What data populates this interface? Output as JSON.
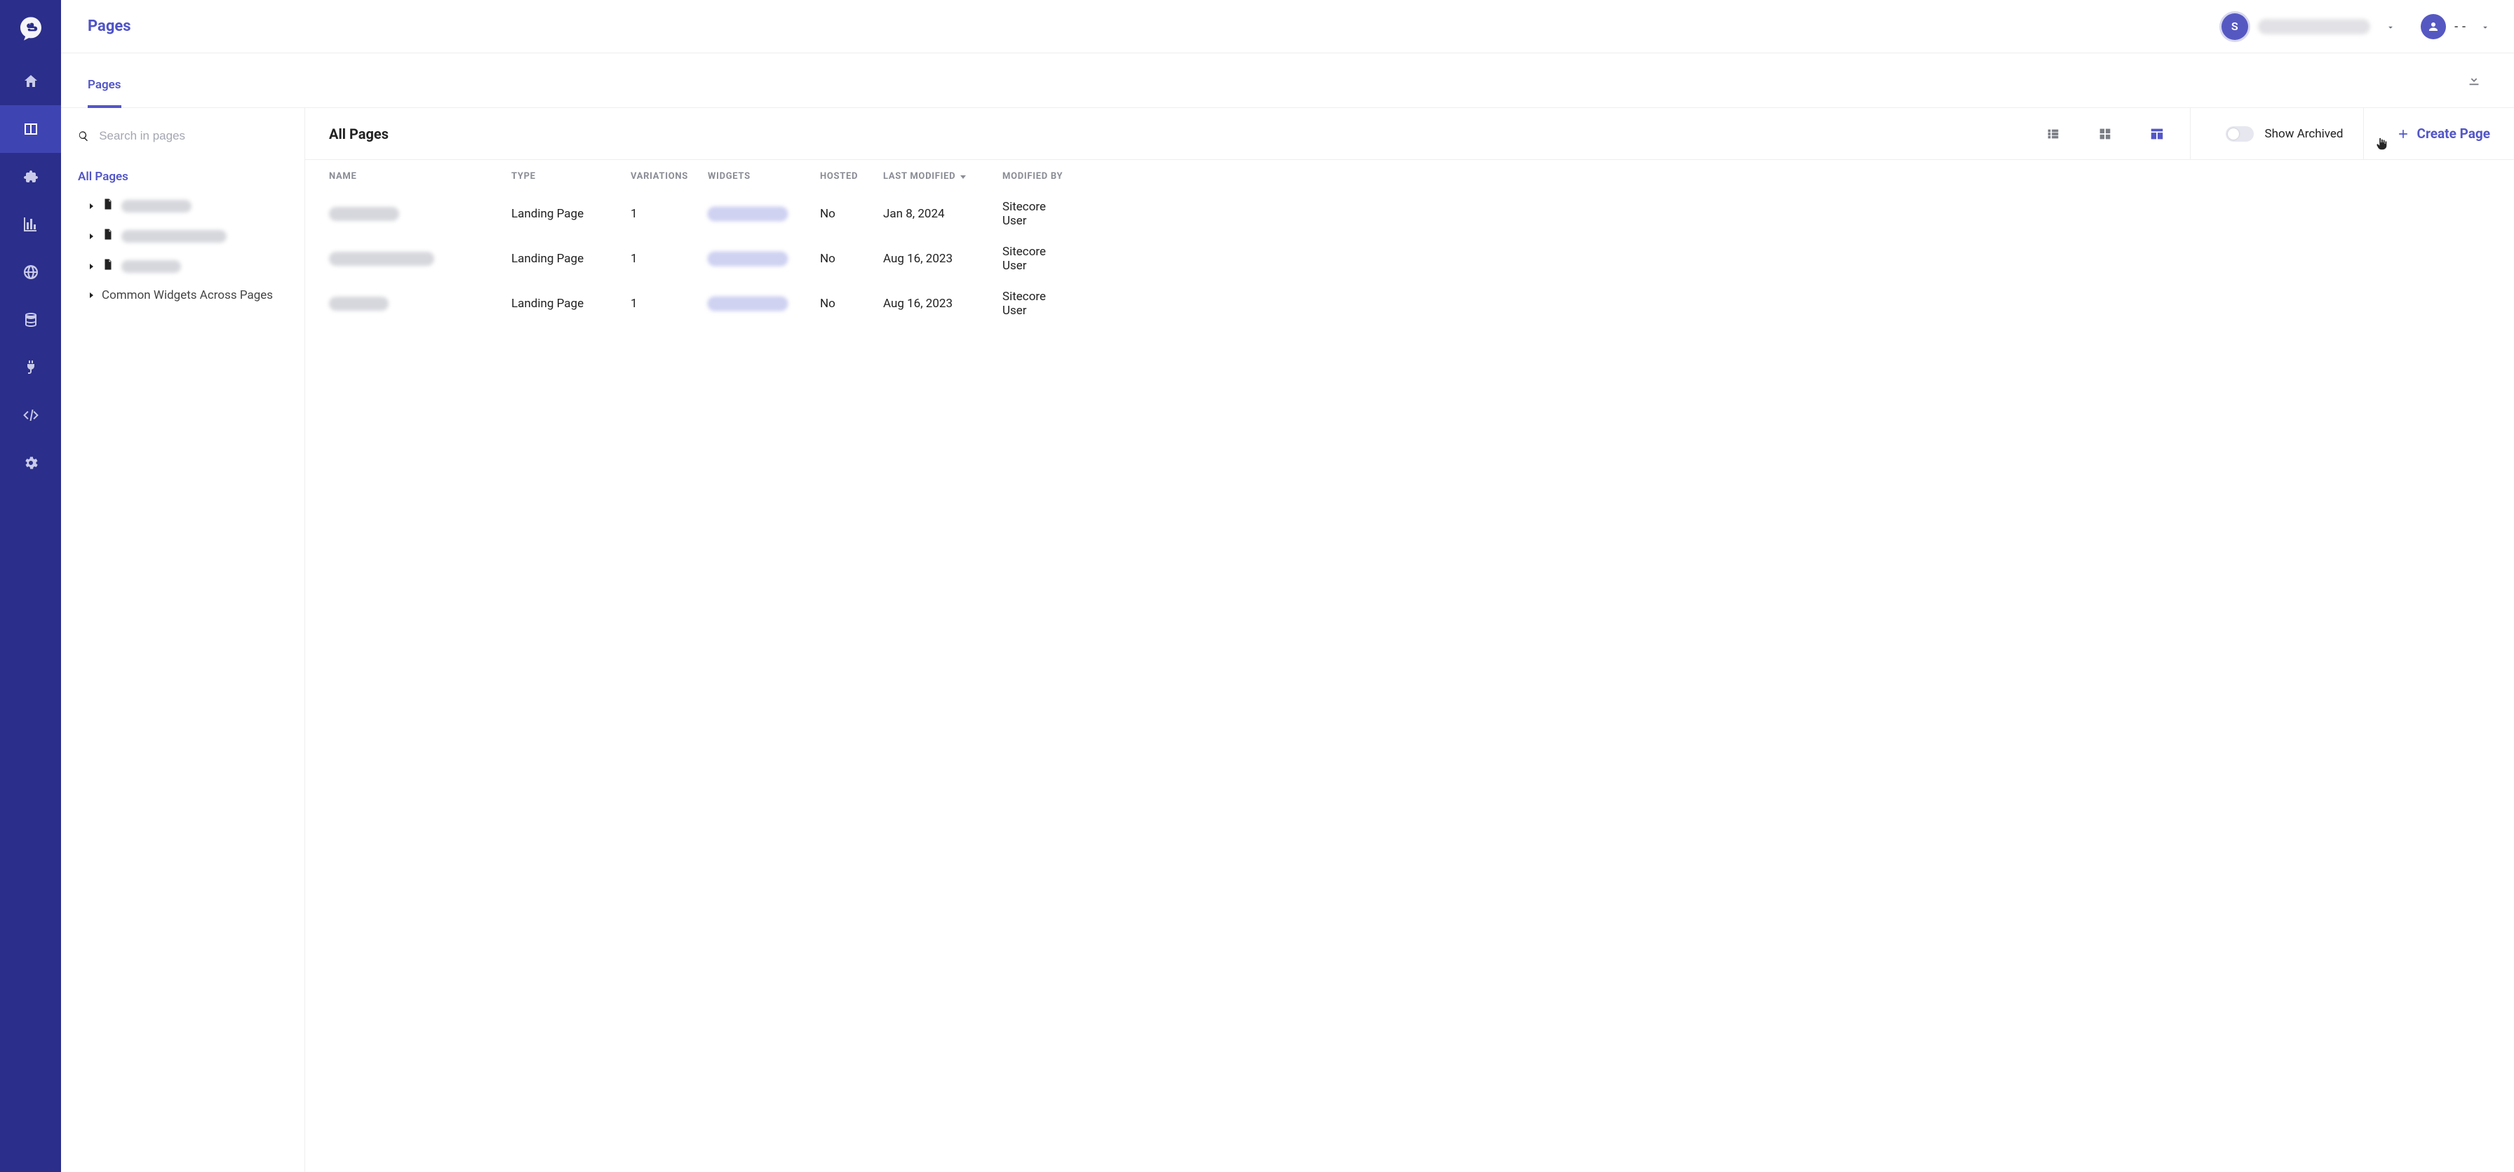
{
  "brand": {
    "initial": "S"
  },
  "header": {
    "title": "Pages",
    "user_label": "- -"
  },
  "tabs": {
    "pages": "Pages"
  },
  "search": {
    "placeholder": "Search in pages"
  },
  "tree": {
    "root": "All Pages",
    "common_widgets": "Common Widgets Across Pages"
  },
  "panel": {
    "title": "All Pages",
    "show_archived": "Show Archived",
    "create_page": "Create Page"
  },
  "table": {
    "cols": {
      "name": "NAME",
      "type": "TYPE",
      "variations": "VARIATIONS",
      "widgets": "WIDGETS",
      "hosted": "HOSTED",
      "last_modified": "LAST MODIFIED",
      "modified_by": "MODIFIED BY"
    },
    "rows": [
      {
        "type": "Landing Page",
        "variations": "1",
        "hosted": "No",
        "last_modified": "Jan 8, 2024",
        "modified_by": "Sitecore User"
      },
      {
        "type": "Landing Page",
        "variations": "1",
        "hosted": "No",
        "last_modified": "Aug 16, 2023",
        "modified_by": "Sitecore User"
      },
      {
        "type": "Landing Page",
        "variations": "1",
        "hosted": "No",
        "last_modified": "Aug 16, 2023",
        "modified_by": "Sitecore User"
      }
    ]
  }
}
